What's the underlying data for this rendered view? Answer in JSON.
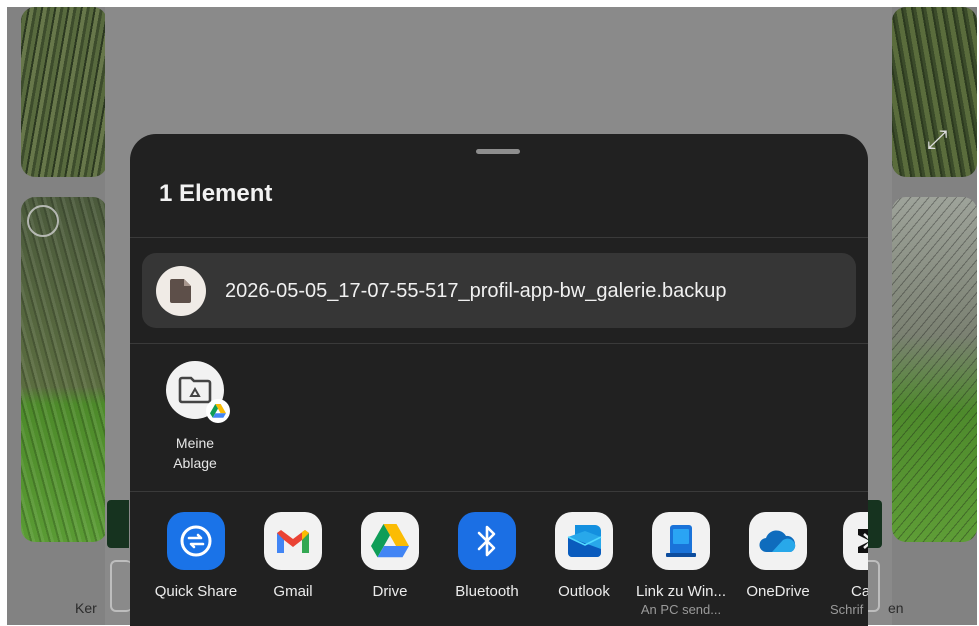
{
  "background": {
    "left_text": "Ker",
    "right_text": "en"
  },
  "sheet": {
    "title": "1 Element",
    "file": {
      "name": "2026-05-05_17-07-55-517_profil-app-bw_galerie.backup",
      "icon": "document-icon"
    },
    "direct_target": {
      "label_line1": "Meine",
      "label_line2": "Ablage",
      "icon": "drive-folder-icon"
    },
    "apps": [
      {
        "label": "Quick Share",
        "sub": "",
        "icon": "quick-share-icon",
        "color": "#1a73e8"
      },
      {
        "label": "Gmail",
        "sub": "",
        "icon": "gmail-icon",
        "color": "#f2f2f2"
      },
      {
        "label": "Drive",
        "sub": "",
        "icon": "google-drive-icon",
        "color": "#f2f2f2"
      },
      {
        "label": "Bluetooth",
        "sub": "",
        "icon": "bluetooth-icon",
        "color": "#1b6fe4"
      },
      {
        "label": "Outlook",
        "sub": "",
        "icon": "outlook-icon",
        "color": "#f2f2f2"
      },
      {
        "label": "Link zu Win...",
        "sub": "An PC send...",
        "icon": "link-to-windows-icon",
        "color": "#f2f2f2"
      },
      {
        "label": "OneDrive",
        "sub": "",
        "icon": "onedrive-icon",
        "color": "#f2f2f2"
      },
      {
        "label": "Ca",
        "sub": "Schrif",
        "icon": "capcut-icon",
        "color": "#f2f2f2"
      }
    ]
  }
}
